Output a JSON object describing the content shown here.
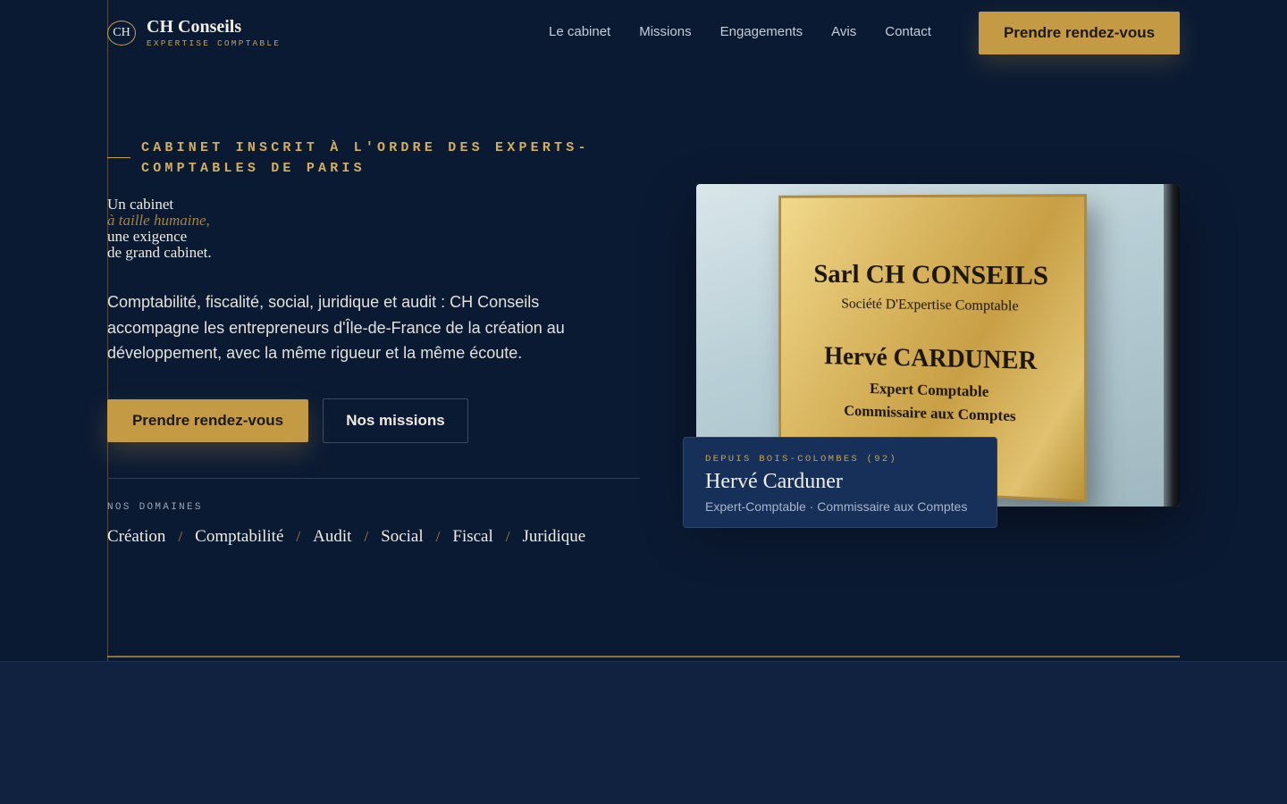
{
  "brand": {
    "mark": "CH",
    "name": "CH Conseils",
    "tagline": "EXPERTISE COMPTABLE"
  },
  "nav": {
    "items": [
      {
        "label": "Le cabinet"
      },
      {
        "label": "Missions"
      },
      {
        "label": "Engagements"
      },
      {
        "label": "Avis"
      },
      {
        "label": "Contact"
      }
    ],
    "cta_label": "Prendre rendez-vous"
  },
  "hero": {
    "eyebrow": "CABINET INSCRIT À L'ORDRE DES EXPERTS-COMPTABLES DE PARIS",
    "headline": {
      "line1": "Un cabinet",
      "line2": "à taille humaine,",
      "line3": "une exigence",
      "line4": "de grand cabinet."
    },
    "lead": "Comptabilité, fiscalité, social, juridique et audit : CH Conseils accompagne les entrepreneurs d'Île-de-France de la création au développement, avec la même rigueur et la même écoute.",
    "primary_cta": "Prendre rendez-vous",
    "secondary_cta": "Nos missions",
    "domains_label": "NOS DOMAINES",
    "domains": [
      "Création",
      "Comptabilité",
      "Audit",
      "Social",
      "Fiscal",
      "Juridique"
    ],
    "domain_separator": "/"
  },
  "plaque": {
    "line1": "Sarl CH CONSEILS",
    "line2": "Société D'Expertise Comptable",
    "line3": "Hervé CARDUNER",
    "line4": "Expert Comptable",
    "line5": "Commissaire aux Comptes"
  },
  "card": {
    "kicker": "DEPUIS BOIS-COLOMBES (92)",
    "name": "Hervé Carduner",
    "role": "Expert-Comptable · Commissaire aux Comptes"
  },
  "colors": {
    "background": "#0b1a33",
    "accent_gold": "#c49a45",
    "card": "#17305a"
  }
}
